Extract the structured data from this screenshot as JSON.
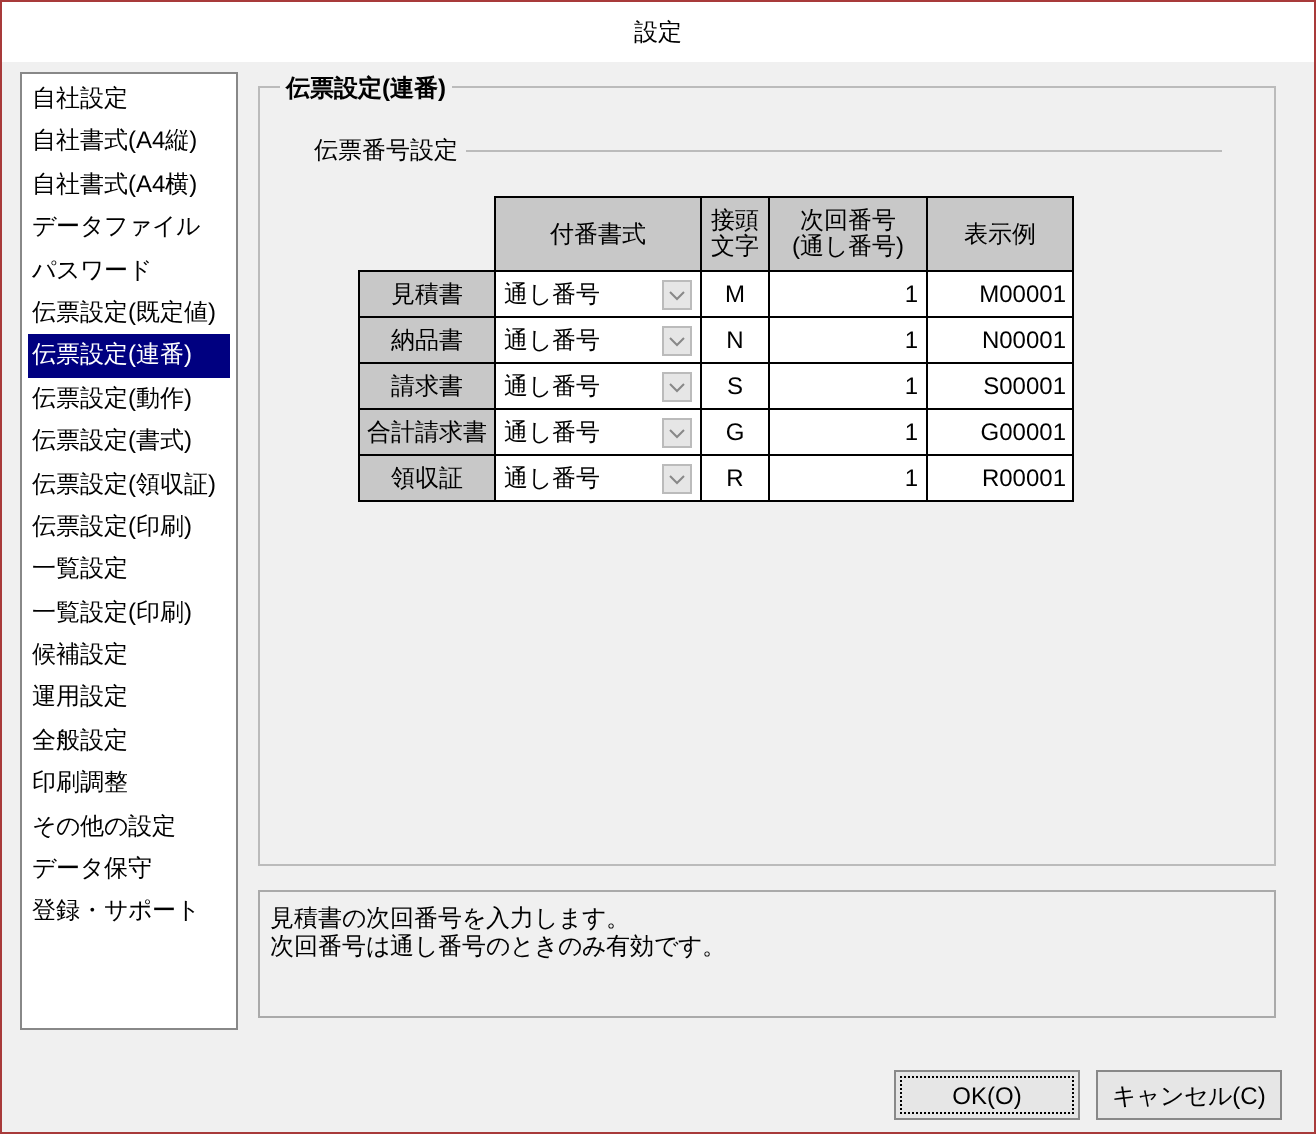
{
  "window": {
    "title": "設定"
  },
  "sidebar": {
    "items": [
      {
        "label": "自社設定",
        "selected": false
      },
      {
        "label": "自社書式(A4縦)",
        "selected": false
      },
      {
        "label": "自社書式(A4横)",
        "selected": false
      },
      {
        "label": "データファイル",
        "selected": false
      },
      {
        "label": "パスワード",
        "selected": false
      },
      {
        "label": "伝票設定(既定値)",
        "selected": false
      },
      {
        "label": "伝票設定(連番)",
        "selected": true
      },
      {
        "label": "伝票設定(動作)",
        "selected": false
      },
      {
        "label": "伝票設定(書式)",
        "selected": false
      },
      {
        "label": "伝票設定(領収証)",
        "selected": false
      },
      {
        "label": "伝票設定(印刷)",
        "selected": false
      },
      {
        "label": "一覧設定",
        "selected": false
      },
      {
        "label": "一覧設定(印刷)",
        "selected": false
      },
      {
        "label": "候補設定",
        "selected": false
      },
      {
        "label": "運用設定",
        "selected": false
      },
      {
        "label": "全般設定",
        "selected": false
      },
      {
        "label": "印刷調整",
        "selected": false
      },
      {
        "label": "その他の設定",
        "selected": false
      },
      {
        "label": "データ保守",
        "selected": false
      },
      {
        "label": "登録・サポート",
        "selected": false
      }
    ]
  },
  "panel": {
    "title": "伝票設定(連番)",
    "section": "伝票番号設定",
    "table": {
      "columns": [
        {
          "lines": [
            "付番書式"
          ]
        },
        {
          "lines": [
            "接頭",
            "文字"
          ]
        },
        {
          "lines": [
            "次回番号",
            "(通し番号)"
          ]
        },
        {
          "lines": [
            "表示例"
          ]
        }
      ],
      "rows": [
        {
          "name": "見積書",
          "format": "通し番号",
          "prefix": "M",
          "next": "1",
          "example": "M00001"
        },
        {
          "name": "納品書",
          "format": "通し番号",
          "prefix": "N",
          "next": "1",
          "example": "N00001"
        },
        {
          "name": "請求書",
          "format": "通し番号",
          "prefix": "S",
          "next": "1",
          "example": "S00001"
        },
        {
          "name": "合計請求書",
          "format": "通し番号",
          "prefix": "G",
          "next": "1",
          "example": "G00001"
        },
        {
          "name": "領収証",
          "format": "通し番号",
          "prefix": "R",
          "next": "1",
          "example": "R00001"
        }
      ]
    }
  },
  "help": [
    "見積書の次回番号を入力します。",
    "次回番号は通し番号のときのみ有効です。"
  ],
  "buttons": [
    "OK(O)",
    "キャンセル(C)"
  ]
}
